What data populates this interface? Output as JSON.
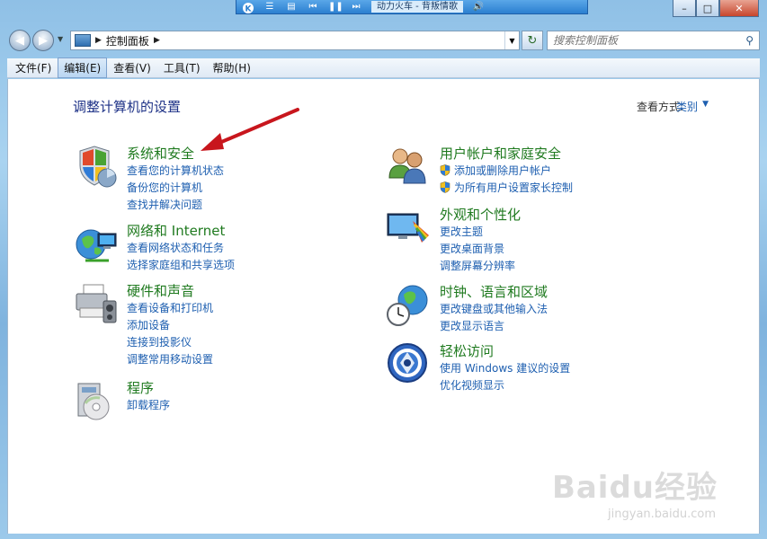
{
  "media_bar": {
    "title": "动力火车 - 背叛情歌"
  },
  "window": {
    "minimize": "–",
    "maximize": "□",
    "close": "✕"
  },
  "address": {
    "path": "控制面板",
    "search_placeholder": "搜索控制面板"
  },
  "menu": [
    "文件(F)",
    "编辑(E)",
    "查看(V)",
    "工具(T)",
    "帮助(H)"
  ],
  "page": {
    "title": "调整计算机的设置",
    "view_by_label": "查看方式:",
    "view_by_value": "类别"
  },
  "categories_left": [
    {
      "title": "系统和安全",
      "links": [
        "查看您的计算机状态",
        "备份您的计算机",
        "查找并解决问题"
      ]
    },
    {
      "title": "网络和 Internet",
      "links": [
        "查看网络状态和任务",
        "选择家庭组和共享选项"
      ]
    },
    {
      "title": "硬件和声音",
      "links": [
        "查看设备和打印机",
        "添加设备",
        "连接到投影仪",
        "调整常用移动设置"
      ]
    },
    {
      "title": "程序",
      "links": [
        "卸载程序"
      ]
    }
  ],
  "categories_right": [
    {
      "title": "用户帐户和家庭安全",
      "links": [
        "添加或删除用户帐户",
        "为所有用户设置家长控制"
      ]
    },
    {
      "title": "外观和个性化",
      "links": [
        "更改主题",
        "更改桌面背景",
        "调整屏幕分辨率"
      ]
    },
    {
      "title": "时钟、语言和区域",
      "links": [
        "更改键盘或其他输入法",
        "更改显示语言"
      ]
    },
    {
      "title": "轻松访问",
      "links": [
        "使用 Windows 建议的设置",
        "优化视频显示"
      ]
    }
  ],
  "watermark": {
    "logo": "Baidu经验",
    "url": "jingyan.baidu.com"
  }
}
